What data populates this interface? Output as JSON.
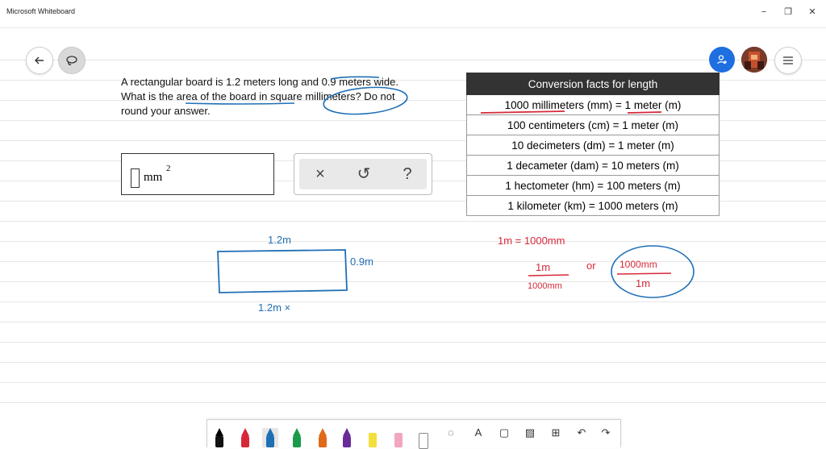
{
  "window": {
    "title": "Microsoft Whiteboard",
    "minimize": "−",
    "restore": "❐",
    "close": "✕"
  },
  "problem": {
    "line1": "A rectangular board is 1.2 meters long and 0.9 meters wide.",
    "line2": "What is the area of the board in square millimeters? Do not",
    "line3": "round your answer."
  },
  "answer": {
    "unit": "mm",
    "exponent": "2"
  },
  "answer_tools": {
    "clear": "×",
    "undo": "↺",
    "help": "?"
  },
  "table": {
    "header": "Conversion facts for length",
    "rows": [
      "1000 millimeters (mm) = 1 meter (m)",
      "100 centimeters (cm) = 1 meter (m)",
      "10 decimeters (dm) = 1 meter (m)",
      "1 decameter (dam) = 10 meters (m)",
      "1 hectometer (hm) = 100 meters (m)",
      "1 kilometer (km) = 1000 meters (m)"
    ]
  },
  "handwriting": {
    "top_length": "1.2m",
    "side_width": "0.9m",
    "bottom": "1.2m ×",
    "equation": "1m = 1000mm",
    "frac1_num": "1m",
    "frac1_den": "1000mm",
    "or": "or",
    "frac2_num": "1000mm",
    "frac2_den": "1m"
  },
  "colors": {
    "ink_blue": "#1f6fb5",
    "ink_red": "#d62838",
    "accent": "#1e6fe0",
    "table_header": "#333333"
  },
  "tray": {
    "text_icon": "A"
  }
}
